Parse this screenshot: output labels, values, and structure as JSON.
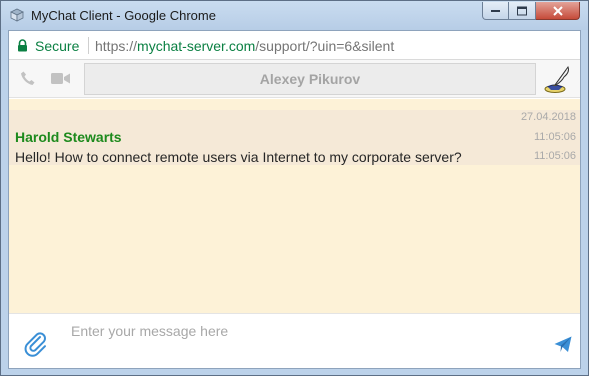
{
  "window": {
    "title": "MyChat Client - Google Chrome",
    "app_icon": "app-icon",
    "controls": [
      "minimize-icon",
      "maximize-icon",
      "close-icon"
    ]
  },
  "addressbar": {
    "secure_label": "Secure",
    "url_prefix": "https://",
    "url_host": "mychat-server.com",
    "url_path": "/support/?uin=6&silent"
  },
  "toolbar": {
    "phone_icon": "phone-icon",
    "video_icon": "video-camera-icon",
    "contact_name": "Alexey Pikurov",
    "quill_icon": "quill-ink-icon"
  },
  "chat": {
    "date": "27.04.2018",
    "messages": [
      {
        "sender": "Harold Stewarts",
        "sender_time": "11:05:06",
        "text": "Hello! How to connect remote users via Internet to my corporate server?",
        "text_time": "11:05:06"
      }
    ]
  },
  "input": {
    "placeholder": "Enter your message here",
    "value": "",
    "attach_icon": "paperclip-icon",
    "send_icon": "send-icon"
  },
  "colors": {
    "sender": "#1d8a1d",
    "chat_background": "#fdf2d7",
    "message_background": "#f5e9d7",
    "secure": "#0b8043",
    "send_accent": "#3a8fd6"
  }
}
